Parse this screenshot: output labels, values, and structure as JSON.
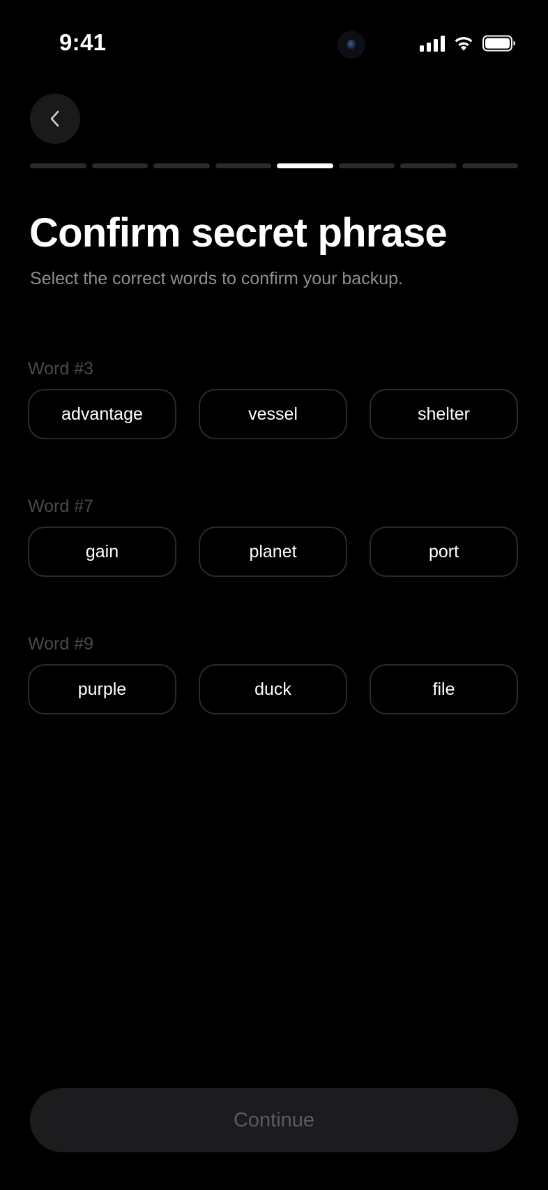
{
  "status_bar": {
    "time": "9:41"
  },
  "progress": {
    "total_steps": 8,
    "current_step": 5
  },
  "header": {
    "title": "Confirm secret phrase",
    "subtitle": "Select the correct words to confirm your backup."
  },
  "word_groups": [
    {
      "label": "Word #3",
      "options": [
        "advantage",
        "vessel",
        "shelter"
      ]
    },
    {
      "label": "Word #7",
      "options": [
        "gain",
        "planet",
        "port"
      ]
    },
    {
      "label": "Word #9",
      "options": [
        "purple",
        "duck",
        "file"
      ]
    }
  ],
  "footer": {
    "continue_label": "Continue"
  },
  "colors": {
    "background": "#000000",
    "option_border": "#2a2a2a",
    "progress_active": "#ffffff",
    "progress_inactive": "#2b2b2b",
    "continue_bg": "#1c1c1e",
    "continue_text": "#5b5b5f"
  }
}
